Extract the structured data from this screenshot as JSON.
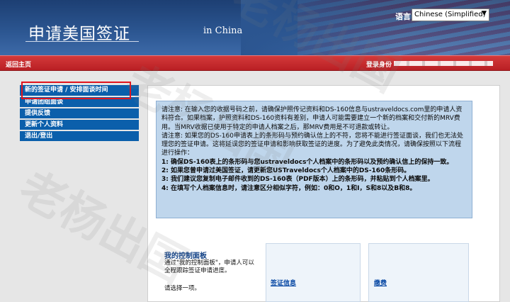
{
  "header": {
    "title": "申请美国签证",
    "subtitle": "in China",
    "language_label": "语言:",
    "language_selected": "Chinese (Simplified)"
  },
  "topbar": {
    "back_home": "返回主页",
    "login_label": "登录身份"
  },
  "sidebar": {
    "items": [
      {
        "label": "新的签证申请 / 安排面谈时间"
      },
      {
        "label": "申请团组面谈"
      },
      {
        "label": "提供反馈"
      },
      {
        "label": "更新个人资料"
      },
      {
        "label": "退出/登出"
      }
    ]
  },
  "notice": {
    "lines": [
      "请注意: 在输入您的收据号码之前，请确保护照传记资料和DS-160信息与ustraveldocs.com里的申请人资料符合。如果档案，护照资料和DS-160资料有差别，申请人可能需要建立一个新的档案和交付新的MRV费用。当MRV收据已使用于特定的申请人档案之后，那MRV费用是不可退款或转让。",
      "请注意: 如果您的DS-160申请表上的条形码与预约确认信上的不符，您将不能进行签证面谈，我们也无法处理您的签证申请。这将延误您的签证申请和影响获取签证的进度。为了避免此类情况，请确保按照以下流程进行操作：",
      "1: 确保DS-160表上的条形码与您ustraveldocs个人档案中的条形码以及预约确认信上的保持一致。",
      "2: 如果您曾申请过美国签证，请更新您USTraveldocs个人档案中的DS-160条形码。",
      "3: 我们建议您复制电子邮件收到的DS-160表（PDF版本）上的条形码，并粘贴到个人档案里。",
      "4: 在填写个人档案信息时，请注意区分相似字符，例如：0和O，1和I，S和8以及B和8。"
    ]
  },
  "dashboard": {
    "title": "我的控制面板",
    "desc": "通过\"我的控制面板\"，申请人可以全程跟踪签证申请进度。",
    "choose": "请选择一项。",
    "links": [
      "签证信息",
      "缴费"
    ]
  },
  "watermark": "老杨出国"
}
